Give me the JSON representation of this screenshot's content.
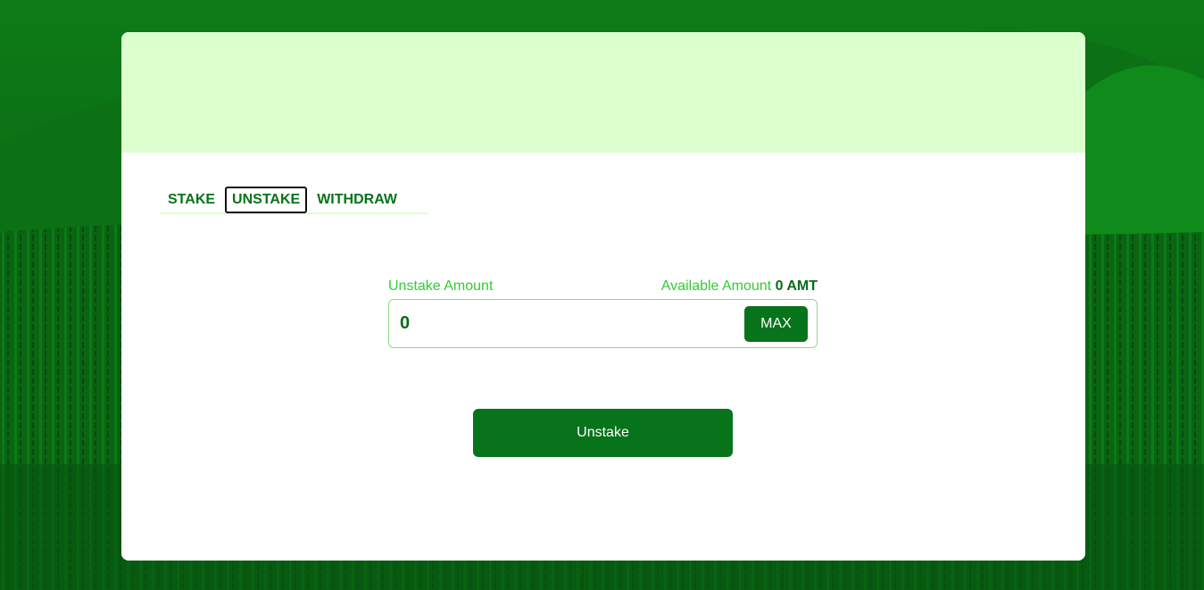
{
  "tabs": [
    {
      "label": "STAKE",
      "active": false
    },
    {
      "label": "UNSTAKE",
      "active": true
    },
    {
      "label": "WITHDRAW",
      "active": false
    }
  ],
  "form": {
    "amount_label": "Unstake Amount",
    "available_label": "Available Amount",
    "available_value": "0 AMT",
    "amount_value": "0",
    "max_label": "MAX"
  },
  "actions": {
    "submit_label": "Unstake"
  },
  "colors": {
    "brand_green": "#07731a",
    "header_bg": "#dcffce",
    "label_green": "#33cc33",
    "background_green": "#0b6e12"
  },
  "icons": {
    "background": "vineyard-landscape-image"
  }
}
